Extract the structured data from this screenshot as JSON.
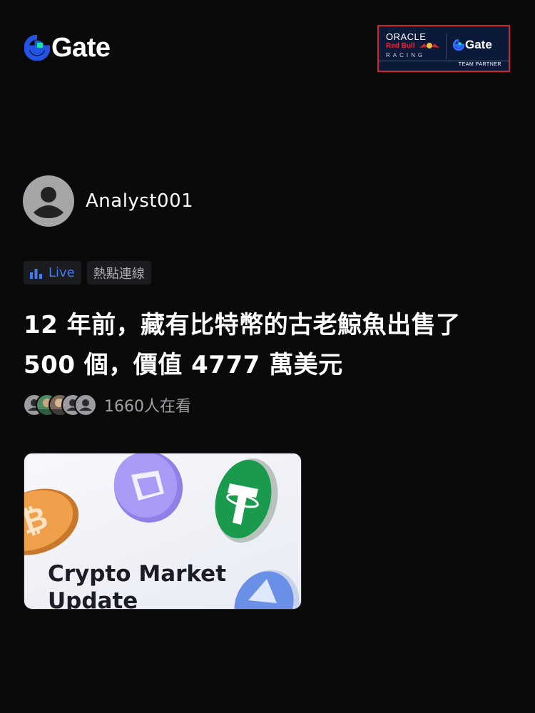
{
  "header": {
    "brand_name": "Gate",
    "partner": {
      "oracle": "ORACLE",
      "redbull": "Red Bull",
      "racing": "RACING",
      "gate": "Gate",
      "team_partner": "TEAM PARTNER"
    }
  },
  "author": {
    "name": "Analyst001"
  },
  "tags": [
    {
      "label": "Live",
      "icon": "bar-chart-icon",
      "color": "#3f7cf5"
    },
    {
      "label": "熱點連線"
    }
  ],
  "article": {
    "title": "12 年前，藏有比特幣的古老鯨魚出售了 500 個，價值 4777 萬美元"
  },
  "viewers": {
    "text": "1660人在看"
  },
  "card": {
    "title": "Crypto Market Update"
  },
  "colors": {
    "background": "#0a0a0b",
    "accent": "#3f7cf5",
    "brand_blue": "#2354e6",
    "brand_green": "#17e6a1",
    "tag_bg": "#1b1c1f"
  }
}
